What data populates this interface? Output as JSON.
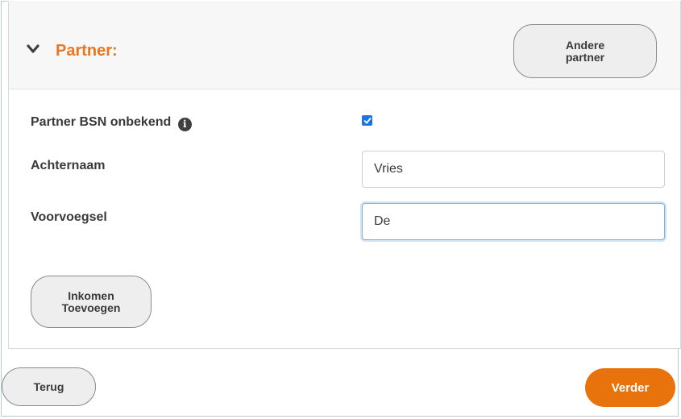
{
  "partner_section": {
    "title": "Partner:",
    "andere_partner_label": "Andere\npartner",
    "fields": {
      "bsn_unknown_label": "Partner BSN onbekend",
      "bsn_unknown_checked": true,
      "achternaam_label": "Achternaam",
      "achternaam_value": "Vries",
      "voorvoegsel_label": "Voorvoegsel",
      "voorvoegsel_value": "De"
    },
    "inkomen_button_label": "Inkomen\nToevoegen"
  },
  "footer": {
    "back_label": "Terug",
    "next_label": "Verder"
  },
  "colors": {
    "accent": "#e87722",
    "next_button": "#e8730c",
    "checkbox": "#1a73e8"
  },
  "icons": {
    "collapse": "chevron-down-icon",
    "info": "info-icon"
  }
}
